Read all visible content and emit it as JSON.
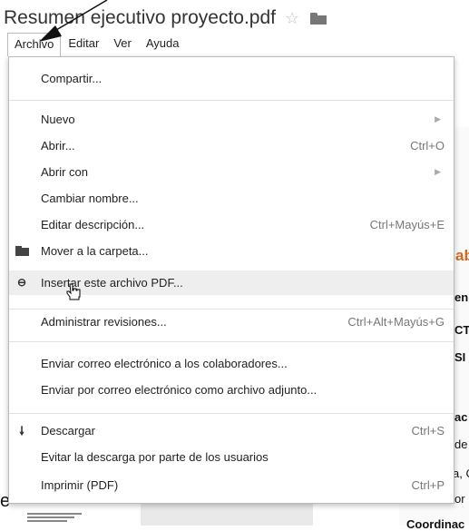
{
  "title": {
    "text": "Resumen ejecutivo proyecto.pdf",
    "star": "☆",
    "folder_icon": "folder-icon"
  },
  "menubar": [
    "Archivo",
    "Editar",
    "Ver",
    "Ayuda"
  ],
  "menu": {
    "share": "Compartir...",
    "new": "Nuevo",
    "open": "Abrir...",
    "open_sc": "Ctrl+O",
    "open_with": "Abrir con",
    "rename": "Cambiar nombre...",
    "edit_desc": "Editar descripción...",
    "edit_desc_sc": "Ctrl+Mayús+E",
    "move": "Mover a la carpeta...",
    "embed": "Insertar este archivo PDF...",
    "revisions": "Administrar revisiones...",
    "revisions_sc": "Ctrl+Alt+Mayús+G",
    "email_collab": "Enviar correo electrónico a los colaboradores...",
    "email_attach": "Enviar por correo electrónico como archivo adjunto...",
    "download": "Descargar",
    "download_sc": "Ctrl+S",
    "prevent": "Evitar la descarga por parte de los usuarios",
    "print": "Imprimir (PDF)",
    "print_sc": "Ctrl+P"
  },
  "background": {
    "frag_ab": "ab",
    "frag_en": "en",
    "frag_ct": "CT",
    "frag_si": "SI",
    "frag_ac": "ac",
    "frag_de": "de",
    "frag_ac2": "a, C",
    "frag_or": "or",
    "frag_coord": "Coordinac",
    "frag_e": "e"
  }
}
